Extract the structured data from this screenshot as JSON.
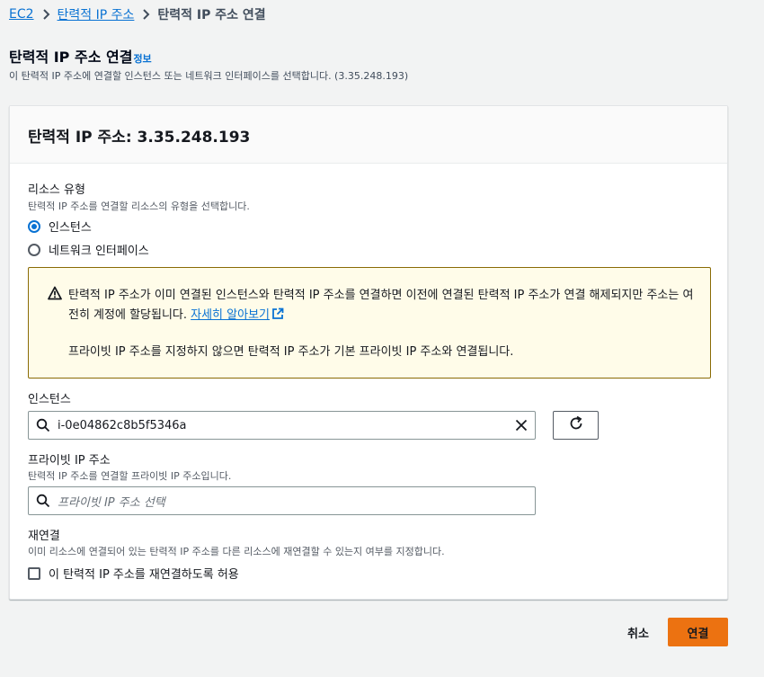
{
  "breadcrumb": {
    "items": [
      "EC2",
      "탄력적 IP 주소"
    ],
    "current": "탄력적 IP 주소 연결"
  },
  "page": {
    "title": "탄력적 IP 주소 연결",
    "info_link": "정보",
    "description": "이 탄력적 IP 주소에 연결할 인스턴스 또는 네트워크 인터페이스를 선택합니다. (3.35.248.193)"
  },
  "panel": {
    "title": "탄력적 IP 주소: 3.35.248.193"
  },
  "resource_type": {
    "label": "리소스 유형",
    "description": "탄력적 IP 주소를 연결할 리소스의 유형을 선택합니다.",
    "options": [
      "인스턴스",
      "네트워크 인터페이스"
    ],
    "selected": "인스턴스"
  },
  "alert": {
    "text1": "탄력적 IP 주소가 이미 연결된 인스턴스와 탄력적 IP 주소를 연결하면 이전에 연결된 탄력적 IP 주소가 연결 해제되지만 주소는 여전히 계정에 할당됩니다.",
    "link": "자세히 알아보기",
    "text2": "프라이빗 IP 주소를 지정하지 않으면 탄력적 IP 주소가 기본 프라이빗 IP 주소와 연결됩니다."
  },
  "instance": {
    "label": "인스턴스",
    "value": "i-0e04862c8b5f5346a"
  },
  "private_ip": {
    "label": "프라이빗 IP 주소",
    "description": "탄력적 IP 주소를 연결할 프라이빗 IP 주소입니다.",
    "placeholder": "프라이빗 IP 주소 선택"
  },
  "reassociation": {
    "label": "재연결",
    "description": "이미 리소스에 연결되어 있는 탄력적 IP 주소를 다른 리소스에 재연결할 수 있는지 여부를 지정합니다.",
    "checkbox_label": "이 탄력적 IP 주소를 재연결하도록 허용",
    "checked": false
  },
  "actions": {
    "cancel": "취소",
    "submit": "연결"
  },
  "colors": {
    "link": "#0972d3",
    "primary_button": "#ec7211",
    "warning_border": "#8a6b05",
    "warning_bg": "#fffce9"
  }
}
